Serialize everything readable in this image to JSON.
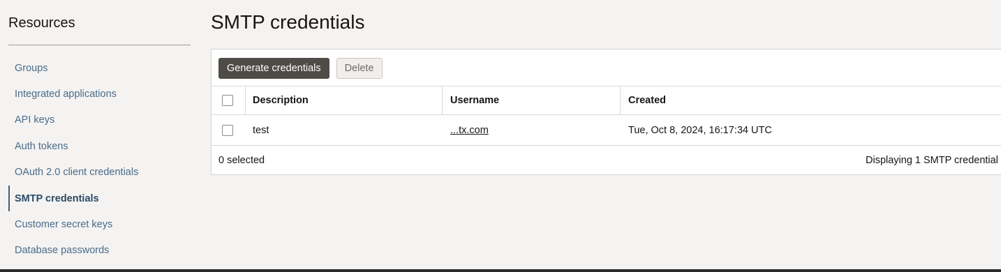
{
  "sidebar": {
    "title": "Resources",
    "items": [
      {
        "label": "Groups"
      },
      {
        "label": "Integrated applications"
      },
      {
        "label": "API keys"
      },
      {
        "label": "Auth tokens"
      },
      {
        "label": "OAuth 2.0 client credentials"
      },
      {
        "label": "SMTP credentials",
        "active": true
      },
      {
        "label": "Customer secret keys"
      },
      {
        "label": "Database passwords"
      }
    ]
  },
  "main": {
    "title": "SMTP credentials",
    "toolbar": {
      "generate_label": "Generate credentials",
      "delete_label": "Delete"
    },
    "table": {
      "columns": [
        "Description",
        "Username",
        "Created"
      ],
      "rows": [
        {
          "description": "test",
          "username": "...tx.com",
          "created": "Tue, Oct 8, 2024, 16:17:34 UTC"
        }
      ]
    },
    "footer": {
      "selected": "0 selected",
      "displaying": "Displaying 1 SMTP credential"
    }
  },
  "colors": {
    "primary_button": "#4f4b47",
    "link": "#4a6b8a",
    "active_nav": "#2c4a66"
  }
}
